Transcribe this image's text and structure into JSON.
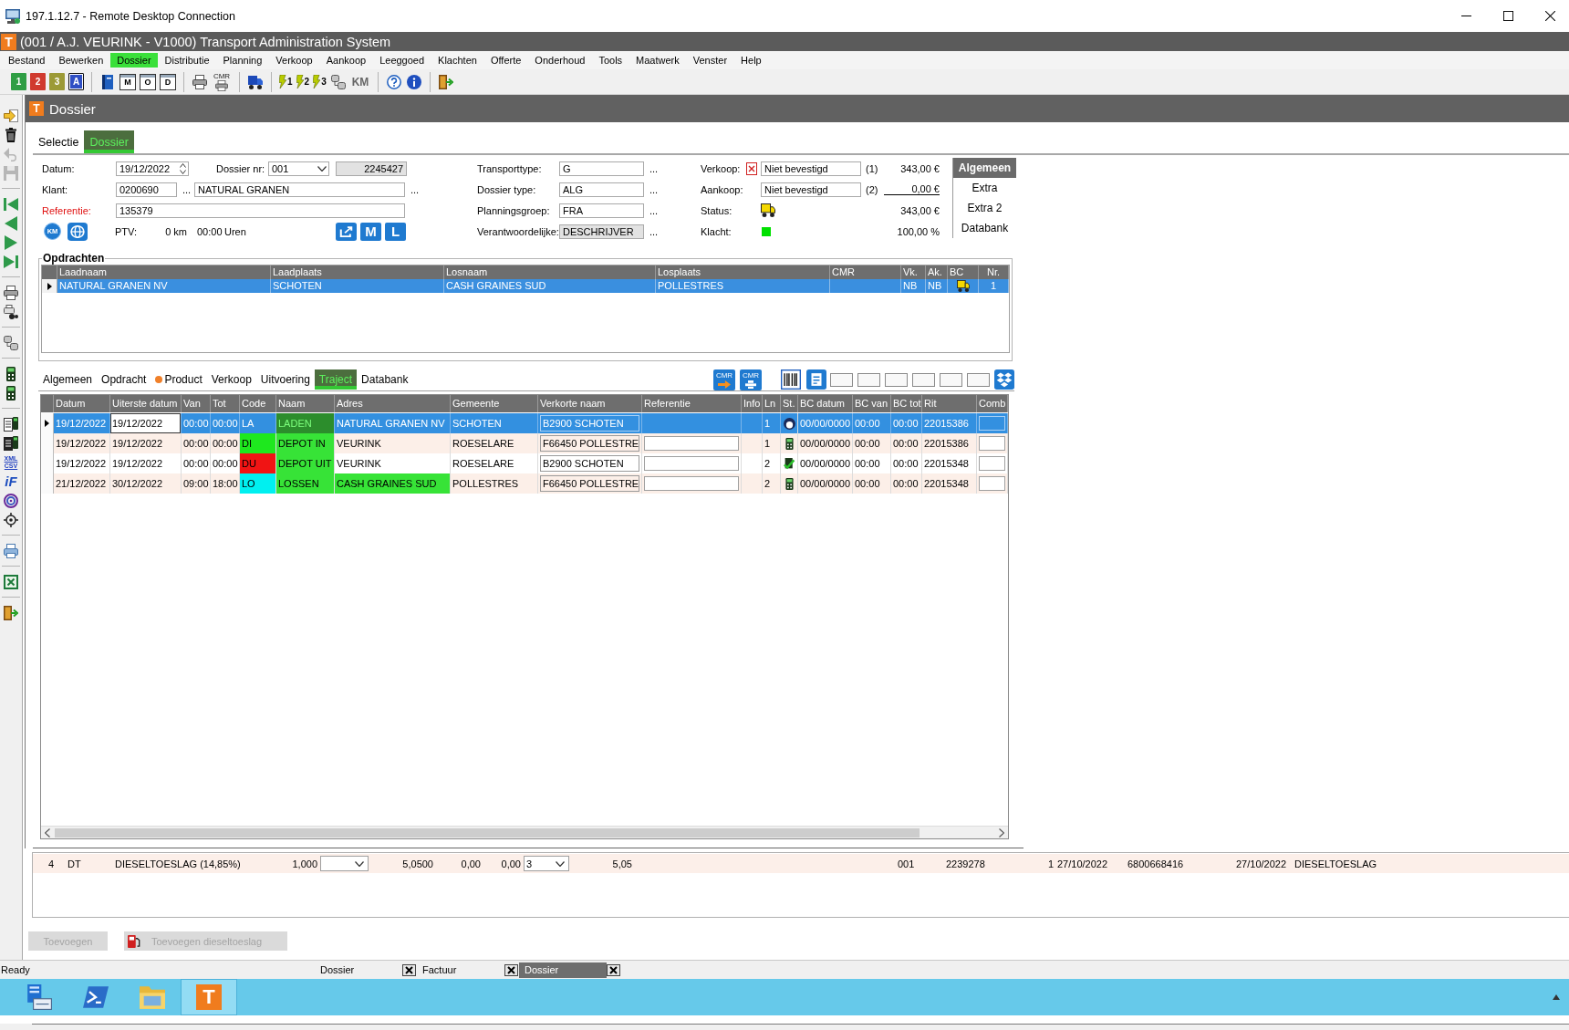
{
  "rdp_window": {
    "title": "197.1.12.7 - Remote Desktop Connection"
  },
  "app_window": {
    "logo": "T",
    "title": "(001 / A.J. VEURINK - V1000) Transport Administration System"
  },
  "menu": [
    {
      "label": "Bestand",
      "highlighted": false
    },
    {
      "label": "Bewerken",
      "highlighted": false
    },
    {
      "label": "Dossier",
      "highlighted": true
    },
    {
      "label": "Distributie",
      "highlighted": false
    },
    {
      "label": "Planning",
      "highlighted": false
    },
    {
      "label": "Verkoop",
      "highlighted": false
    },
    {
      "label": "Aankoop",
      "highlighted": false
    },
    {
      "label": "Leeggoed",
      "highlighted": false
    },
    {
      "label": "Klachten",
      "highlighted": false
    },
    {
      "label": "Offerte",
      "highlighted": false
    },
    {
      "label": "Onderhoud",
      "highlighted": false
    },
    {
      "label": "Tools",
      "highlighted": false
    },
    {
      "label": "Maatwerk",
      "highlighted": false
    },
    {
      "label": "Venster",
      "highlighted": false
    },
    {
      "label": "Help",
      "highlighted": false
    }
  ],
  "toolbar": [
    [
      {
        "kind": "document",
        "label": "1",
        "color": "#2f9e44",
        "pressed": false
      },
      {
        "kind": "document",
        "label": "2",
        "color": "#d03a2e",
        "pressed": false
      },
      {
        "kind": "document",
        "label": "3",
        "color": "#9c9a36",
        "pressed": false
      },
      {
        "kind": "document",
        "label": "A",
        "color": "#2f4fc4",
        "pressed": true
      }
    ],
    [
      {
        "kind": "book",
        "pressed": false
      },
      {
        "kind": "form",
        "label": "M",
        "pressed": false
      },
      {
        "kind": "form",
        "label": "O",
        "pressed": false
      },
      {
        "kind": "form",
        "label": "D",
        "pressed": false
      }
    ],
    [
      {
        "kind": "printer",
        "pressed": false
      },
      {
        "kind": "cmr-printer",
        "label": "CMR",
        "pressed": false
      }
    ],
    [
      {
        "kind": "truck",
        "pressed": false
      }
    ],
    [
      {
        "kind": "route",
        "label": "1",
        "pressed": false
      },
      {
        "kind": "route",
        "label": "2",
        "pressed": false
      },
      {
        "kind": "route",
        "label": "3",
        "pressed": false
      },
      {
        "kind": "database",
        "pressed": false
      },
      {
        "kind": "text",
        "label": "KM",
        "pressed": false
      }
    ],
    [
      {
        "kind": "help",
        "pressed": false
      },
      {
        "kind": "info",
        "pressed": false
      }
    ],
    [
      {
        "kind": "exit",
        "pressed": false
      }
    ]
  ],
  "side_toolbar": [
    [
      {
        "kind": "login",
        "disabled": false
      },
      {
        "kind": "trash",
        "disabled": false
      },
      {
        "kind": "undo",
        "disabled": true
      },
      {
        "kind": "save",
        "disabled": true
      }
    ],
    [
      {
        "kind": "first",
        "disabled": false
      },
      {
        "kind": "previous",
        "disabled": false
      },
      {
        "kind": "next",
        "disabled": false
      },
      {
        "kind": "last",
        "disabled": false
      }
    ],
    [
      {
        "kind": "printer",
        "disabled": false
      },
      {
        "kind": "print-search",
        "disabled": false
      }
    ],
    [
      {
        "kind": "database",
        "disabled": false
      }
    ],
    [
      {
        "kind": "handheld",
        "disabled": false
      },
      {
        "kind": "handheld",
        "disabled": false
      }
    ],
    [
      {
        "kind": "list-handheld",
        "disabled": false
      },
      {
        "kind": "list-handheld-dark",
        "disabled": false
      },
      {
        "kind": "xml-csv",
        "lines": [
          "XML",
          "CSV"
        ],
        "disabled": false
      },
      {
        "kind": "text",
        "label": "iF",
        "disabled": false
      },
      {
        "kind": "spiral",
        "disabled": false
      },
      {
        "kind": "target",
        "disabled": false
      }
    ],
    [
      {
        "kind": "fax",
        "disabled": false
      }
    ],
    [
      {
        "kind": "excel",
        "disabled": false
      }
    ],
    [
      {
        "kind": "exit",
        "disabled": false
      }
    ]
  ],
  "dossier_window": {
    "logo": "T",
    "title": "Dossier",
    "tabs": [
      {
        "label": "Selectie",
        "selected": false,
        "highlighted": false
      },
      {
        "label": "Dossier",
        "selected": true,
        "highlighted": true
      }
    ],
    "form": {
      "datum": {
        "label": "Datum:",
        "value": "19/12/2022"
      },
      "dossier_nr": {
        "label": "Dossier nr:",
        "value": "001",
        "number": "2245427"
      },
      "klant": {
        "label": "Klant:",
        "code": "0200690",
        "name": "NATURAL GRANEN",
        "browse": [
          "...",
          "..."
        ]
      },
      "referentie": {
        "label": "Referentie:",
        "value": "135379",
        "required": true
      },
      "ptv": {
        "km_button": "KM",
        "label": "PTV:",
        "distance": "0 km",
        "time": "00:00",
        "unit": "Uren",
        "buttons": [
          "M",
          "L"
        ]
      },
      "middle": [
        {
          "label": "Transporttype:",
          "value": "G",
          "browse": "...",
          "readonly": false
        },
        {
          "label": "Dossier type:",
          "value": "ALG",
          "browse": "...",
          "readonly": false
        },
        {
          "label": "Planningsgroep:",
          "value": "FRA",
          "browse": "...",
          "readonly": false
        },
        {
          "label": "Verantwoordelijke:",
          "value": "DESCHRIJVER",
          "browse": "...",
          "readonly": true
        }
      ],
      "right": [
        {
          "kind": "status",
          "label": "Verkoop:",
          "flagged": true,
          "value": "Niet bevestigd",
          "index": "(1)",
          "amount": "343,00 €",
          "underlined": false
        },
        {
          "kind": "status",
          "label": "Aankoop:",
          "flagged": false,
          "value": "Niet bevestigd",
          "index": "(2)",
          "amount": "0,00 €",
          "underlined": true
        },
        {
          "kind": "truck",
          "label": "Status:",
          "amount": "343,00 €",
          "underlined": false
        },
        {
          "kind": "swatch",
          "label": "Klacht:",
          "color": "#00e000",
          "amount": "100,00 %",
          "underlined": false
        }
      ]
    },
    "side_tabs": [
      {
        "label": "Algemeen",
        "selected": true
      },
      {
        "label": "Extra",
        "selected": false
      },
      {
        "label": "Extra 2",
        "selected": false
      },
      {
        "label": "Databank",
        "selected": false
      }
    ],
    "opdrachten": {
      "title": "Opdrachten",
      "columns": [
        "Laadnaam",
        "Laadplaats",
        "Losnaam",
        "Losplaats",
        "CMR",
        "Vk.",
        "Ak.",
        "BC",
        "Nr."
      ],
      "rows": [
        {
          "selected": true,
          "laadnaam": "NATURAL GRANEN NV",
          "laadplaats": "SCHOTEN",
          "losnaam": "CASH GRAINES SUD",
          "losplaats": "POLLESTRES",
          "vk": "NB",
          "ak": "NB",
          "nr": "1"
        }
      ]
    },
    "detail_tabs": [
      {
        "label": "Algemeen",
        "selected": false,
        "highlighted": false,
        "dot": false
      },
      {
        "label": "Opdracht",
        "selected": false,
        "highlighted": false,
        "dot": false
      },
      {
        "label": "Product",
        "selected": false,
        "highlighted": false,
        "dot": true
      },
      {
        "label": "Verkoop",
        "selected": false,
        "highlighted": false,
        "dot": false
      },
      {
        "label": "Uitvoering",
        "selected": false,
        "highlighted": false,
        "dot": false
      },
      {
        "label": "Traject",
        "selected": true,
        "highlighted": true,
        "dot": false
      },
      {
        "label": "Databank",
        "selected": false,
        "highlighted": false,
        "dot": false
      }
    ],
    "detail_tools": [
      {
        "kind": "cmr-export",
        "label": "CMR"
      },
      {
        "kind": "cmr-print",
        "label": "CMR"
      },
      {
        "kind": "barcode"
      },
      {
        "kind": "document"
      },
      {
        "kind": "blank"
      },
      {
        "kind": "blank"
      },
      {
        "kind": "blank"
      },
      {
        "kind": "blank"
      },
      {
        "kind": "blank"
      },
      {
        "kind": "blank"
      },
      {
        "kind": "dropbox"
      }
    ],
    "traject": {
      "columns": [
        "Datum",
        "Uiterste datum",
        "Van",
        "Tot",
        "Code",
        "Naam",
        "Adres",
        "Gemeente",
        "Verkorte naam",
        "Referentie",
        "Info",
        "Ln",
        "St.",
        "BC datum",
        "BC van",
        "BC tot",
        "Rit",
        "Comb"
      ],
      "rows": [
        {
          "selected": true,
          "datum": "19/12/2022",
          "uiterste_datum": "19/12/2022",
          "van": "00:00",
          "tot": "00:00",
          "code": {
            "text": "LA"
          },
          "naam": {
            "text": "LADEN",
            "highlighted": true
          },
          "adres": {
            "text": "NATURAL GRANEN NV",
            "highlighted": false
          },
          "gemeente": "SCHOTEN",
          "verkorte_naam": "B2900 SCHOTEN",
          "ln": "1",
          "st": {
            "kind": "person"
          },
          "bc_datum": "00/00/0000",
          "bc_van": "00:00",
          "bc_tot": "00:00",
          "rit": "22015386"
        },
        {
          "selected": false,
          "datum": "19/12/2022",
          "uiterste_datum": "19/12/2022",
          "van": "00:00",
          "tot": "00:00",
          "code": {
            "text": "DI",
            "color": "#1ee81e"
          },
          "naam": {
            "text": "DEPOT IN",
            "highlighted": true
          },
          "adres": {
            "text": "VEURINK",
            "highlighted": false
          },
          "gemeente": "ROESELARE",
          "verkorte_naam": "F66450 POLLESTRE",
          "ln": "1",
          "st": {
            "kind": "handheld"
          },
          "bc_datum": "00/00/0000",
          "bc_van": "00:00",
          "bc_tot": "00:00",
          "rit": "22015386"
        },
        {
          "selected": false,
          "datum": "19/12/2022",
          "uiterste_datum": "19/12/2022",
          "van": "00:00",
          "tot": "00:00",
          "code": {
            "text": "DU",
            "color": "#f01414"
          },
          "naam": {
            "text": "DEPOT UIT",
            "highlighted": true
          },
          "adres": {
            "text": "VEURINK",
            "highlighted": false
          },
          "gemeente": "ROESELARE",
          "verkorte_naam": "B2900 SCHOTEN",
          "ln": "2",
          "st": {
            "kind": "check"
          },
          "bc_datum": "00/00/0000",
          "bc_van": "00:00",
          "bc_tot": "00:00",
          "rit": "22015348"
        },
        {
          "selected": false,
          "datum": "21/12/2022",
          "uiterste_datum": "30/12/2022",
          "van": "09:00",
          "tot": "18:00",
          "code": {
            "text": "LO",
            "color": "#00f0f0"
          },
          "naam": {
            "text": "LOSSEN",
            "highlighted": true
          },
          "adres": {
            "text": "CASH GRAINES SUD",
            "highlighted": true
          },
          "gemeente": "POLLESTRES",
          "verkorte_naam": "F66450 POLLESTRE",
          "ln": "2",
          "st": {
            "kind": "handheld"
          },
          "bc_datum": "00/00/0000",
          "bc_van": "00:00",
          "bc_tot": "00:00",
          "rit": "22015348"
        }
      ]
    }
  },
  "background_window": {
    "lines": [
      {
        "cells": [
          {
            "kind": "text",
            "text": "4"
          },
          {
            "kind": "text",
            "text": "DT"
          },
          {
            "kind": "text",
            "text": "DIESELTOESLAG (14,85%)"
          },
          {
            "kind": "text",
            "text": "1,000"
          },
          {
            "kind": "dropdown"
          },
          {
            "kind": "text",
            "text": "5,0500"
          },
          {
            "kind": "text",
            "text": "0,00"
          },
          {
            "kind": "text",
            "text": "0,00"
          },
          {
            "kind": "dropdown",
            "value": "3"
          },
          {
            "kind": "text",
            "text": "5,05"
          },
          {
            "kind": "text",
            "text": "001"
          },
          {
            "kind": "text",
            "text": "2239278"
          },
          {
            "kind": "text",
            "text": "1"
          },
          {
            "kind": "text",
            "text": "27/10/2022"
          },
          {
            "kind": "text",
            "text": "6800668416"
          },
          {
            "kind": "text",
            "text": "27/10/2022"
          },
          {
            "kind": "text",
            "text": "DIESELTOESLAG"
          }
        ]
      }
    ],
    "buttons": [
      {
        "kind": "plain",
        "label": "Toevoegen",
        "disabled": true
      },
      {
        "kind": "fuel",
        "label": "Toevoegen dieseltoeslag",
        "disabled": true
      }
    ]
  },
  "status_bar": {
    "text": "Ready",
    "windows": [
      {
        "label": "Dossier",
        "selected": false
      },
      {
        "label": "Factuur",
        "selected": false
      },
      {
        "label": "Dossier",
        "selected": true
      }
    ]
  },
  "taskbar": {
    "apps": [
      {
        "kind": "server",
        "active": false
      },
      {
        "kind": "terminal",
        "active": false
      },
      {
        "kind": "folder",
        "active": false
      },
      {
        "kind": "logo",
        "logo": "T",
        "active": true
      }
    ]
  }
}
